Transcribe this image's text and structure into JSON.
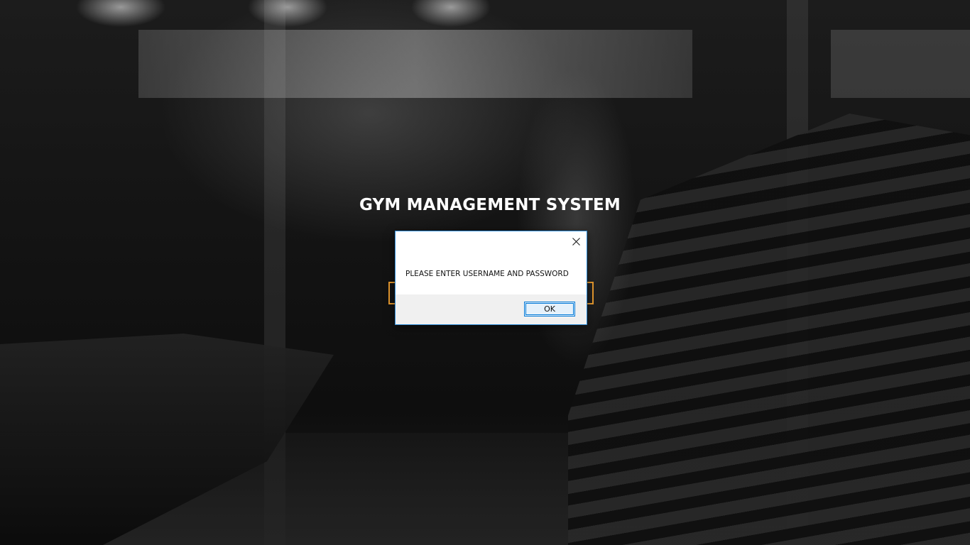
{
  "app": {
    "title": "GYM MANAGEMENT SYSTEM"
  },
  "dialog": {
    "message": "PLEASE ENTER USERNAME AND PASSWORD",
    "ok_label": "OK",
    "close_icon": "close-icon",
    "accent_color": "#0078d7"
  },
  "theme": {
    "title_color": "#ffffff",
    "field_border_color": "#e69a2e"
  }
}
